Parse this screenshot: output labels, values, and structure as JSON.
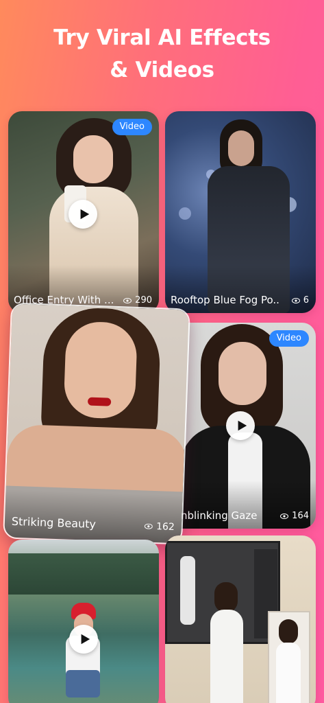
{
  "header": {
    "title_line1": "Try Viral AI Effects",
    "title_line2": "& Videos"
  },
  "cards": [
    {
      "caption": "Office Entry With ...",
      "views": "290",
      "badge": "Video",
      "has_play": true
    },
    {
      "caption": "Rooftop Blue Fog Po...",
      "views": "6",
      "badge": "",
      "has_play": false
    },
    {
      "caption": "Striking Beauty",
      "views": "162",
      "badge": "",
      "has_play": false
    },
    {
      "caption": "Unblinking Gaze",
      "views": "164",
      "badge": "Video",
      "has_play": true
    },
    {
      "caption": "",
      "views": "",
      "badge": "",
      "has_play": true
    },
    {
      "caption": "",
      "views": "",
      "badge": "",
      "has_play": false
    }
  ],
  "icons": {
    "play": "play-icon",
    "views": "eye-icon"
  },
  "colors": {
    "badge": "#2d87ff",
    "background_start": "#ff8a5c",
    "background_end": "#ff5aa0"
  }
}
